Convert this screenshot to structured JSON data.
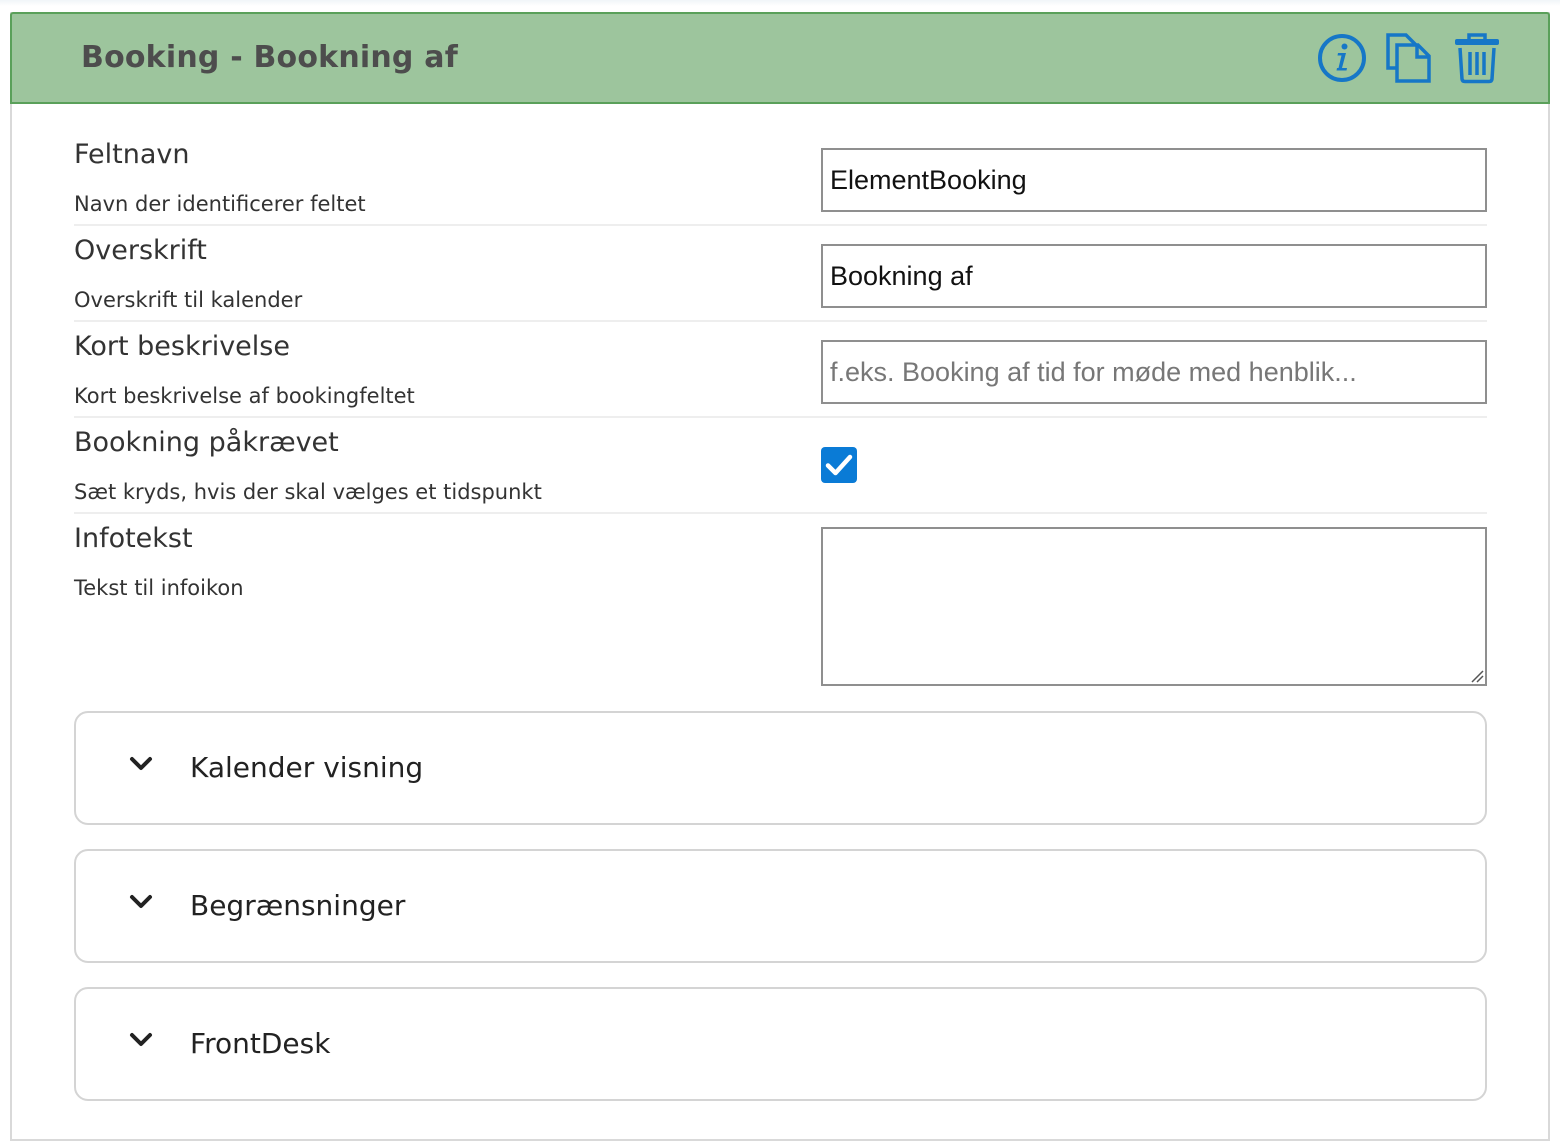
{
  "header": {
    "title": "Booking - Bookning af",
    "accent_color": "#1677c7",
    "background_color": "#9dc59d"
  },
  "fields": {
    "feltnavn": {
      "label": "Feltnavn",
      "help": "Navn der identificerer feltet",
      "value": "ElementBooking",
      "placeholder": ""
    },
    "overskrift": {
      "label": "Overskrift",
      "help": "Overskrift til kalender",
      "value": "Bookning af",
      "placeholder": ""
    },
    "kort_beskrivelse": {
      "label": "Kort beskrivelse",
      "help": "Kort beskrivelse af bookingfeltet",
      "value": "",
      "placeholder": "f.eks. Booking af tid for møde med henblik..."
    },
    "bookning_paakraevet": {
      "label": "Bookning påkrævet",
      "help": "Sæt kryds, hvis der skal vælges et tidspunkt",
      "checked": true
    },
    "infotekst": {
      "label": "Infotekst",
      "help": "Tekst til infoikon",
      "value": ""
    }
  },
  "sections": [
    {
      "label": "Kalender visning",
      "expanded": false
    },
    {
      "label": "Begrænsninger",
      "expanded": false
    },
    {
      "label": "FrontDesk",
      "expanded": false
    }
  ],
  "icons": {
    "info": "info-icon",
    "copy": "copy-icon",
    "delete": "trash-icon",
    "checkbox": "checkmark-icon",
    "chevron": "chevron-down-icon"
  }
}
